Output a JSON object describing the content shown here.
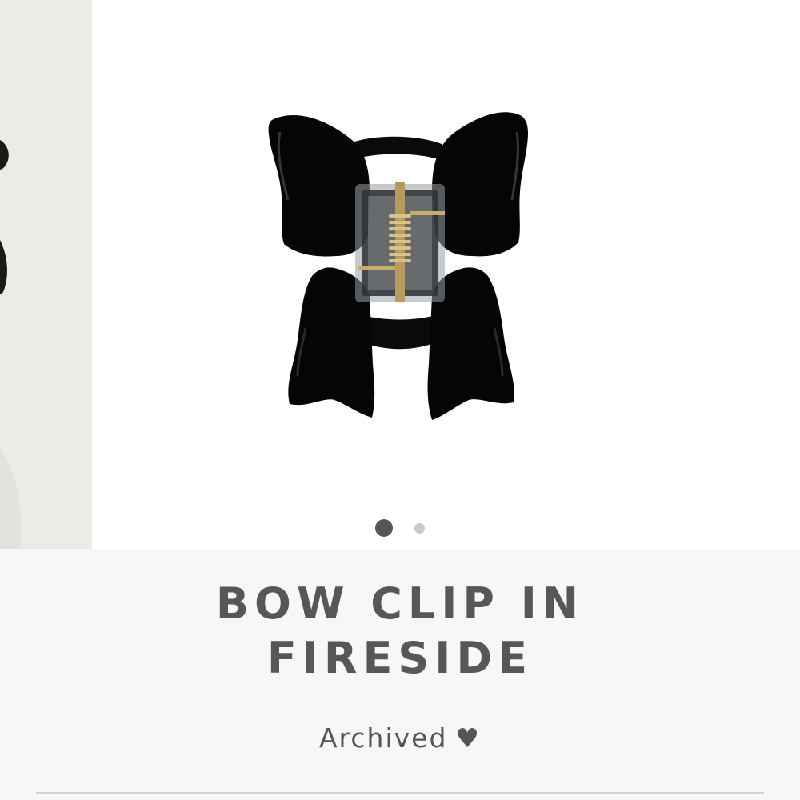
{
  "product": {
    "title_line1": "BOW CLIP IN",
    "title_line2": "FIRESIDE",
    "status": "Archived",
    "status_icon": "♥"
  },
  "gallery": {
    "slide_count": 2,
    "active_slide": 1,
    "main_image": "black-bow-claw-clip-photo",
    "prev_image": "partial-model-photo"
  },
  "colors": {
    "title_text": "#575757",
    "dot_active": "#555555",
    "dot_inactive": "#c9c9c9",
    "clip_black": "#050505",
    "info_background": "#f7f7f7"
  }
}
